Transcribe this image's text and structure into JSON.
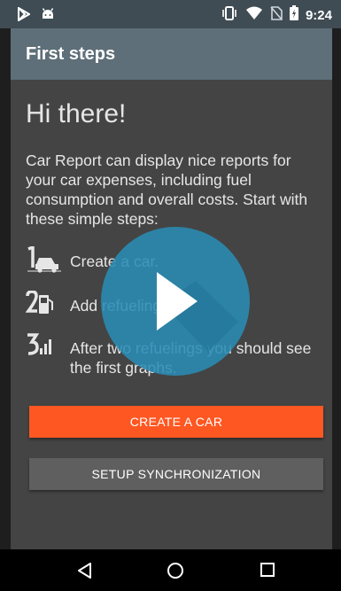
{
  "status_bar": {
    "time": "9:24",
    "icons": [
      "play-store-icon",
      "android-icon",
      "vibrate-icon",
      "wifi-icon",
      "no-sim-icon",
      "battery-icon"
    ]
  },
  "app_bar": {
    "title": "First steps"
  },
  "main": {
    "headline": "Hi there!",
    "intro": "Car Report can display nice reports for your car expenses, including fuel consumption and overall costs. Start with these simple steps:",
    "steps": [
      {
        "icon": "step-1-car-icon",
        "text": "Create a car."
      },
      {
        "icon": "step-2-fuel-icon",
        "text": "Add refuelings."
      },
      {
        "icon": "step-3-graph-icon",
        "text": "After two refuelings you should see the first graphs."
      }
    ],
    "buttons": {
      "create_car": "CREATE A CAR",
      "setup_sync": "SETUP SYNCHRONIZATION"
    }
  },
  "nav_bar": {
    "icons": [
      "back-icon",
      "home-icon",
      "recents-icon"
    ]
  },
  "overlay": {
    "icon": "play-icon"
  },
  "colors": {
    "status_bar": "#3f4c54",
    "app_bar": "#5e6f79",
    "content_bg": "#444444",
    "primary_button": "#ff5722",
    "secondary_button": "#5f5f5f",
    "play_overlay": "#2a8cb4"
  }
}
